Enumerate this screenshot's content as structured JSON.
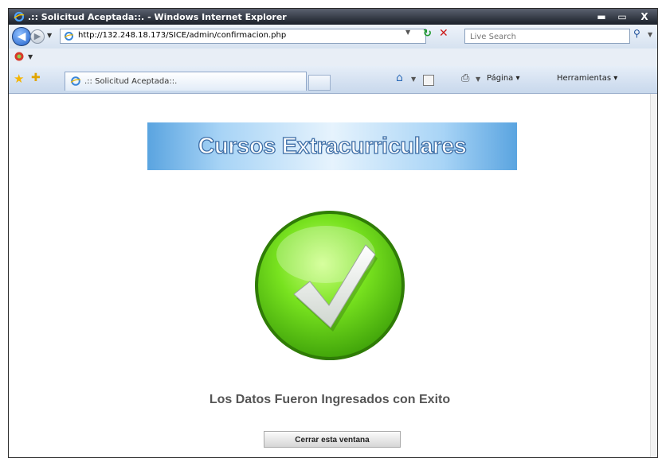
{
  "window": {
    "title": ".:: Solicitud Aceptada::. - Windows Internet Explorer",
    "controls": {
      "minimize": "▬",
      "maximize": "▭",
      "close": "X"
    }
  },
  "address_bar": {
    "url": "http://132.248.18.173/SICE/admin/confirmacion.php",
    "search_placeholder": "Live Search"
  },
  "tabs": [
    {
      "label": ".:: Solicitud Aceptada::."
    }
  ],
  "command_bar": {
    "page_menu": "Página ▾",
    "tools_menu": "Herramientas ▾"
  },
  "page": {
    "banner_text": "Cursos Extracurriculares",
    "message": "Los Datos Fueron Ingresados con Exito",
    "close_button": "Cerrar esta ventana"
  },
  "colors": {
    "check_green": "#6fdc1e",
    "check_dark": "#3d9c0a",
    "banner_blue": "#5aa4e0"
  },
  "icons": {
    "ie_logo": "ie-logo-icon",
    "back": "back-arrow-icon",
    "forward": "forward-arrow-icon",
    "refresh": "refresh-icon",
    "stop": "stop-icon",
    "search": "search-icon",
    "favorites": "favorites-star-icon",
    "home": "home-icon",
    "print": "print-icon",
    "check": "checkmark-icon"
  }
}
